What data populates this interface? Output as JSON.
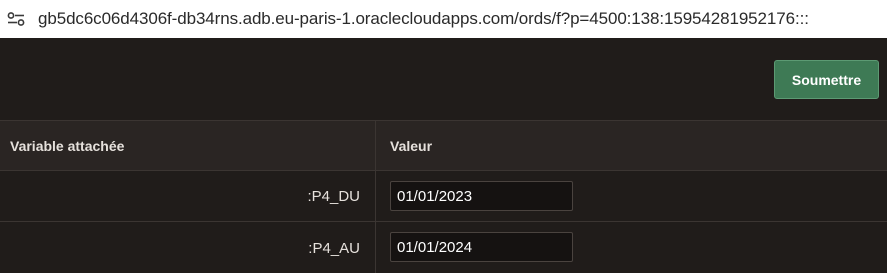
{
  "browser": {
    "url": "gb5dc6c06d4306f-db34rns.adb.eu-paris-1.oraclecloudapps.com/ords/f?p=4500:138:15954281952176:::",
    "site_info_icon": "tune-icon"
  },
  "toolbar": {
    "submit_label": "Soumettre"
  },
  "table": {
    "headers": [
      "Variable attachée",
      "Valeur"
    ],
    "rows": [
      {
        "variable": ":P4_DU",
        "value": "01/01/2023"
      },
      {
        "variable": ":P4_AU",
        "value": "01/01/2024"
      }
    ]
  },
  "colors": {
    "background": "#201c1a",
    "header_bg": "#2a2523",
    "button_bg": "#3e7a55",
    "input_bg": "#151211"
  }
}
